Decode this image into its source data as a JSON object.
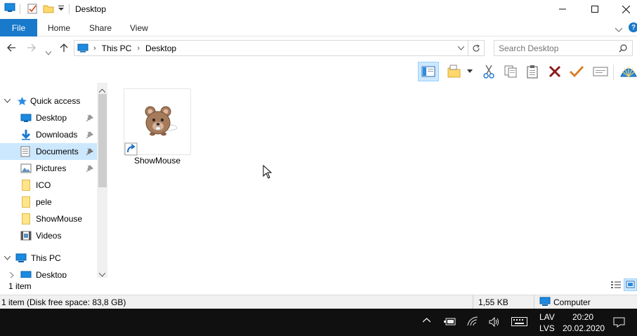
{
  "window": {
    "title": "Desktop"
  },
  "ribbon": {
    "tabs": [
      "File",
      "Home",
      "Share",
      "View"
    ]
  },
  "address": {
    "segments": [
      "This PC",
      "Desktop"
    ]
  },
  "search": {
    "placeholder": "Search Desktop"
  },
  "nav": {
    "quick_access": "Quick access",
    "items": [
      {
        "label": "Desktop",
        "icon": "desktop-icon",
        "pinned": true
      },
      {
        "label": "Downloads",
        "icon": "download-icon",
        "pinned": true
      },
      {
        "label": "Documents",
        "icon": "documents-icon",
        "pinned": true,
        "selected": true
      },
      {
        "label": "Pictures",
        "icon": "pictures-icon",
        "pinned": true
      },
      {
        "label": "ICO",
        "icon": "folder-icon"
      },
      {
        "label": "pele",
        "icon": "folder-icon"
      },
      {
        "label": "ShowMouse",
        "icon": "folder-icon"
      },
      {
        "label": "Videos",
        "icon": "videos-icon"
      }
    ],
    "this_pc": "This PC",
    "this_pc_children": [
      {
        "label": "Desktop"
      }
    ]
  },
  "files": [
    {
      "name": "ShowMouse",
      "icon": "mouse-shortcut-icon"
    }
  ],
  "status": {
    "item_count": "1 item"
  },
  "infobar": {
    "summary": "1 item (Disk free space: 83,8 GB)",
    "size": "1,55 KB",
    "location": "Computer"
  },
  "taskbar": {
    "lang_top": "LAV",
    "lang_bottom": "LVS",
    "time": "20:20",
    "date": "20.02.2020"
  },
  "colors": {
    "accent": "#1979ca",
    "selection": "#cce8ff",
    "folder": "#ffd86b",
    "taskbar": "#101010"
  }
}
